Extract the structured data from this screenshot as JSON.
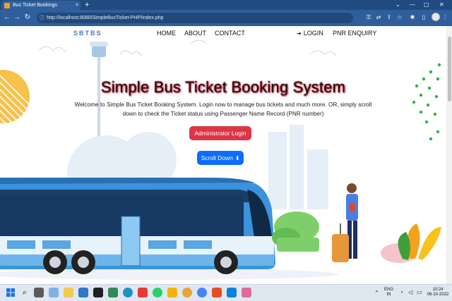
{
  "browser": {
    "tab_title": "Bus Ticket Bookings",
    "tab_close": "×",
    "new_tab": "+",
    "url": "http://localhost:8080/SimpleBusTicket-PHP/index.php",
    "window_controls": [
      "⌄",
      "—",
      "▢",
      "✕"
    ]
  },
  "nav": {
    "brand": "SBTBS",
    "links": [
      "HOME",
      "ABOUT",
      "CONTACT"
    ],
    "login": "LOGIN",
    "pnr": "PNR ENQUIRY"
  },
  "hero": {
    "title": "Simple Bus Ticket Booking System",
    "description": "Welcome to Simple Bus Ticket Booking System. Login now to manage bus tickets and much more. OR, simply scroll down to check the Ticket status using Passenger Name Record (PNR number)",
    "admin_button": "Administrator Login",
    "scroll_button": "Scroll Down",
    "scroll_icon": "⬇"
  },
  "taskbar": {
    "lang_top": "ENG",
    "lang_bottom": "IN",
    "time": "10:24",
    "date": "06-10-2022"
  },
  "colors": {
    "admin_button": "#dc3545",
    "scroll_button": "#0d6efd",
    "title_glow": "#c0102a",
    "browser_chrome": "#2e5f9c"
  }
}
